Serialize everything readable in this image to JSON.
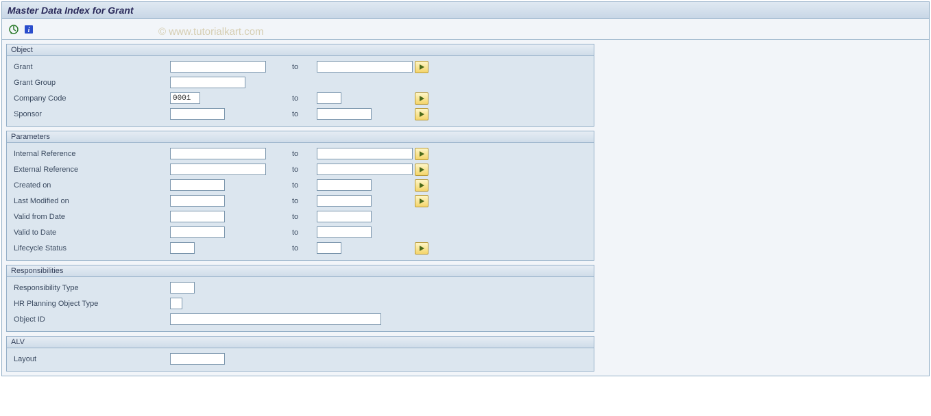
{
  "title": "Master Data Index for Grant",
  "watermark": "© www.tutorialkart.com",
  "groups": {
    "object": {
      "title": "Object",
      "labels": {
        "grant": "Grant",
        "grantGroup": "Grant Group",
        "companyCode": "Company Code",
        "sponsor": "Sponsor"
      },
      "values": {
        "companyCode": "0001"
      },
      "to": "to"
    },
    "parameters": {
      "title": "Parameters",
      "labels": {
        "internalRef": "Internal Reference",
        "externalRef": "External Reference",
        "createdOn": "Created on",
        "lastModified": "Last Modified on",
        "validFrom": "Valid from Date",
        "validTo": "Valid to Date",
        "lifecycle": "Lifecycle Status"
      },
      "to": "to"
    },
    "responsibilities": {
      "title": "Responsibilities",
      "labels": {
        "respType": "Responsibility Type",
        "hrPlanning": "HR Planning Object Type",
        "objectId": "Object ID"
      }
    },
    "alv": {
      "title": "ALV",
      "labels": {
        "layout": "Layout"
      }
    }
  }
}
